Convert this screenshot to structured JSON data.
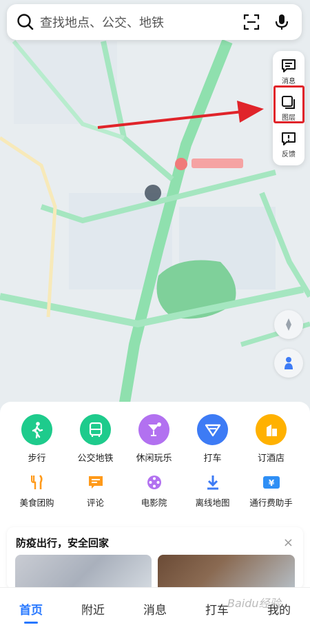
{
  "search": {
    "placeholder": "查找地点、公交、地铁"
  },
  "toolbar": {
    "items": [
      {
        "label": "消息",
        "icon": "message-icon"
      },
      {
        "label": "图层",
        "icon": "layers-icon"
      },
      {
        "label": "反馈",
        "icon": "feedback-icon"
      }
    ]
  },
  "services": {
    "primary": [
      {
        "label": "步行",
        "icon": "walk-icon",
        "color": "#1ecb8c"
      },
      {
        "label": "公交地铁",
        "icon": "bus-icon",
        "color": "#1ecb8c"
      },
      {
        "label": "休闲玩乐",
        "icon": "cocktail-icon",
        "color": "#b271f0"
      },
      {
        "label": "打车",
        "icon": "taxi-icon",
        "color": "#3d7bf5"
      },
      {
        "label": "订酒店",
        "icon": "hotel-icon",
        "color": "#ffb100"
      }
    ],
    "secondary": [
      {
        "label": "美食团购",
        "icon": "food-icon",
        "color": "#ff9a1a"
      },
      {
        "label": "评论",
        "icon": "comment-icon",
        "color": "#ff9a1a"
      },
      {
        "label": "电影院",
        "icon": "film-icon",
        "color": "#b271f0"
      },
      {
        "label": "离线地图",
        "icon": "download-icon",
        "color": "#3d7bf5"
      },
      {
        "label": "通行费助手",
        "icon": "toll-icon",
        "color": "#2f8ff5"
      }
    ]
  },
  "banner": {
    "title": "防疫出行，安全回家",
    "close": "×"
  },
  "nav": {
    "items": [
      {
        "label": "首页"
      },
      {
        "label": "附近"
      },
      {
        "label": "消息"
      },
      {
        "label": "打车"
      },
      {
        "label": "我的"
      }
    ]
  },
  "watermark": "Baidu经验"
}
